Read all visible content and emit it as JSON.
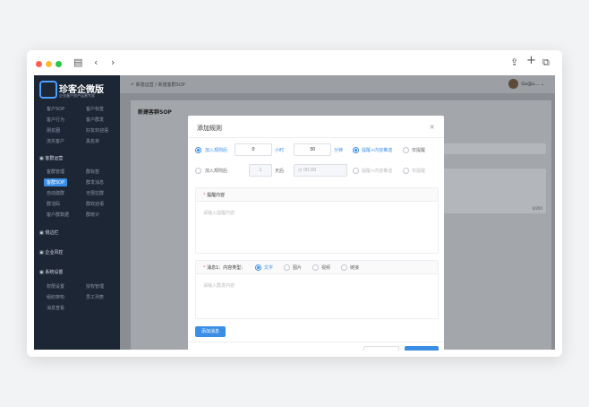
{
  "chrome": {
    "dot_colors": [
      "#ff5f57",
      "#febc2e",
      "#28c840"
    ]
  },
  "logo": {
    "name": "珍客企微版",
    "tagline": "企业客户资产运营专家"
  },
  "sidebar": {
    "top_rows": [
      [
        "客户SOP",
        "客户标签"
      ],
      [
        "客户行为",
        "客户群发"
      ],
      [
        "朋友圈",
        "好友欢迎语"
      ],
      [
        "流失客户",
        "黑名单"
      ]
    ],
    "group1": "客群运营",
    "group1_rows": [
      [
        "客群管理",
        "群标签"
      ],
      [
        "客群SOP",
        "群发消息"
      ],
      [
        "自动建群",
        "无限拉群"
      ],
      [
        "群活码",
        "群欢迎语"
      ],
      [
        "客户群数据",
        "群统计"
      ]
    ],
    "group2": "侧边栏",
    "group3": "企业风控",
    "group4": "系统设置",
    "group4_rows": [
      [
        "权限设置",
        "授权管理"
      ],
      [
        "组织架构",
        "员工列表"
      ],
      [
        "消息查看",
        ""
      ]
    ]
  },
  "topbar": {
    "breadcrumb": "新建运营 / 新建客群SOP",
    "username": "Gu@u..."
  },
  "page": {
    "title": "新建客群SOP"
  },
  "modal": {
    "title": "添加规则",
    "close": "×",
    "row1": {
      "label": "加入规则后",
      "hours": "0",
      "hours_unit": "小时",
      "minutes": "30",
      "minutes_unit": "分钟",
      "opt1": "提醒+内容推送",
      "opt2": "仅提醒"
    },
    "row2": {
      "label": "加入规则后",
      "days": "1",
      "days_unit": "天后",
      "time": "00:00",
      "opt1": "提醒+内容推送",
      "opt2": "仅提醒"
    },
    "remind": {
      "label": "提醒内容",
      "placeholder": "请输入提醒内容"
    },
    "msg": {
      "label": "消息1：内容类型：",
      "types": [
        "文字",
        "图片",
        "视频",
        "链接"
      ],
      "placeholder": "请输入群发内容"
    },
    "add_button": "添加消息"
  },
  "bg_counter": "0/200"
}
